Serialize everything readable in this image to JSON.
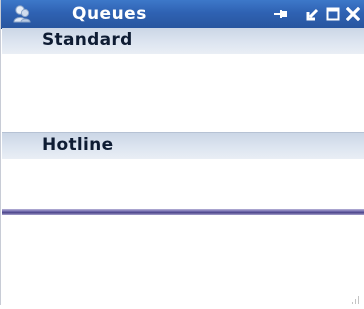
{
  "window": {
    "title": "Queues",
    "title_color": "#ffffff",
    "titlebar_color": "#2f62b3",
    "icons": {
      "app": "queues-app-icon",
      "pin": "pin-icon",
      "restore": "restore-icon",
      "maximize": "maximize-icon",
      "close": "close-icon"
    }
  },
  "queues": [
    {
      "label": "Standard"
    },
    {
      "label": "Hotline"
    }
  ]
}
